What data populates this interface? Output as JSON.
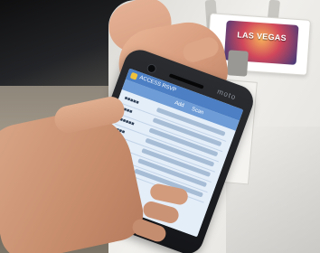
{
  "scene": {
    "badge": {
      "text": "LAS VEGAS"
    },
    "phone": {
      "brand": "moto",
      "screen": {
        "app_title": "ACCESS RSVP",
        "tabs": [
          "Add",
          "Scan"
        ],
        "rows": 7
      }
    }
  }
}
